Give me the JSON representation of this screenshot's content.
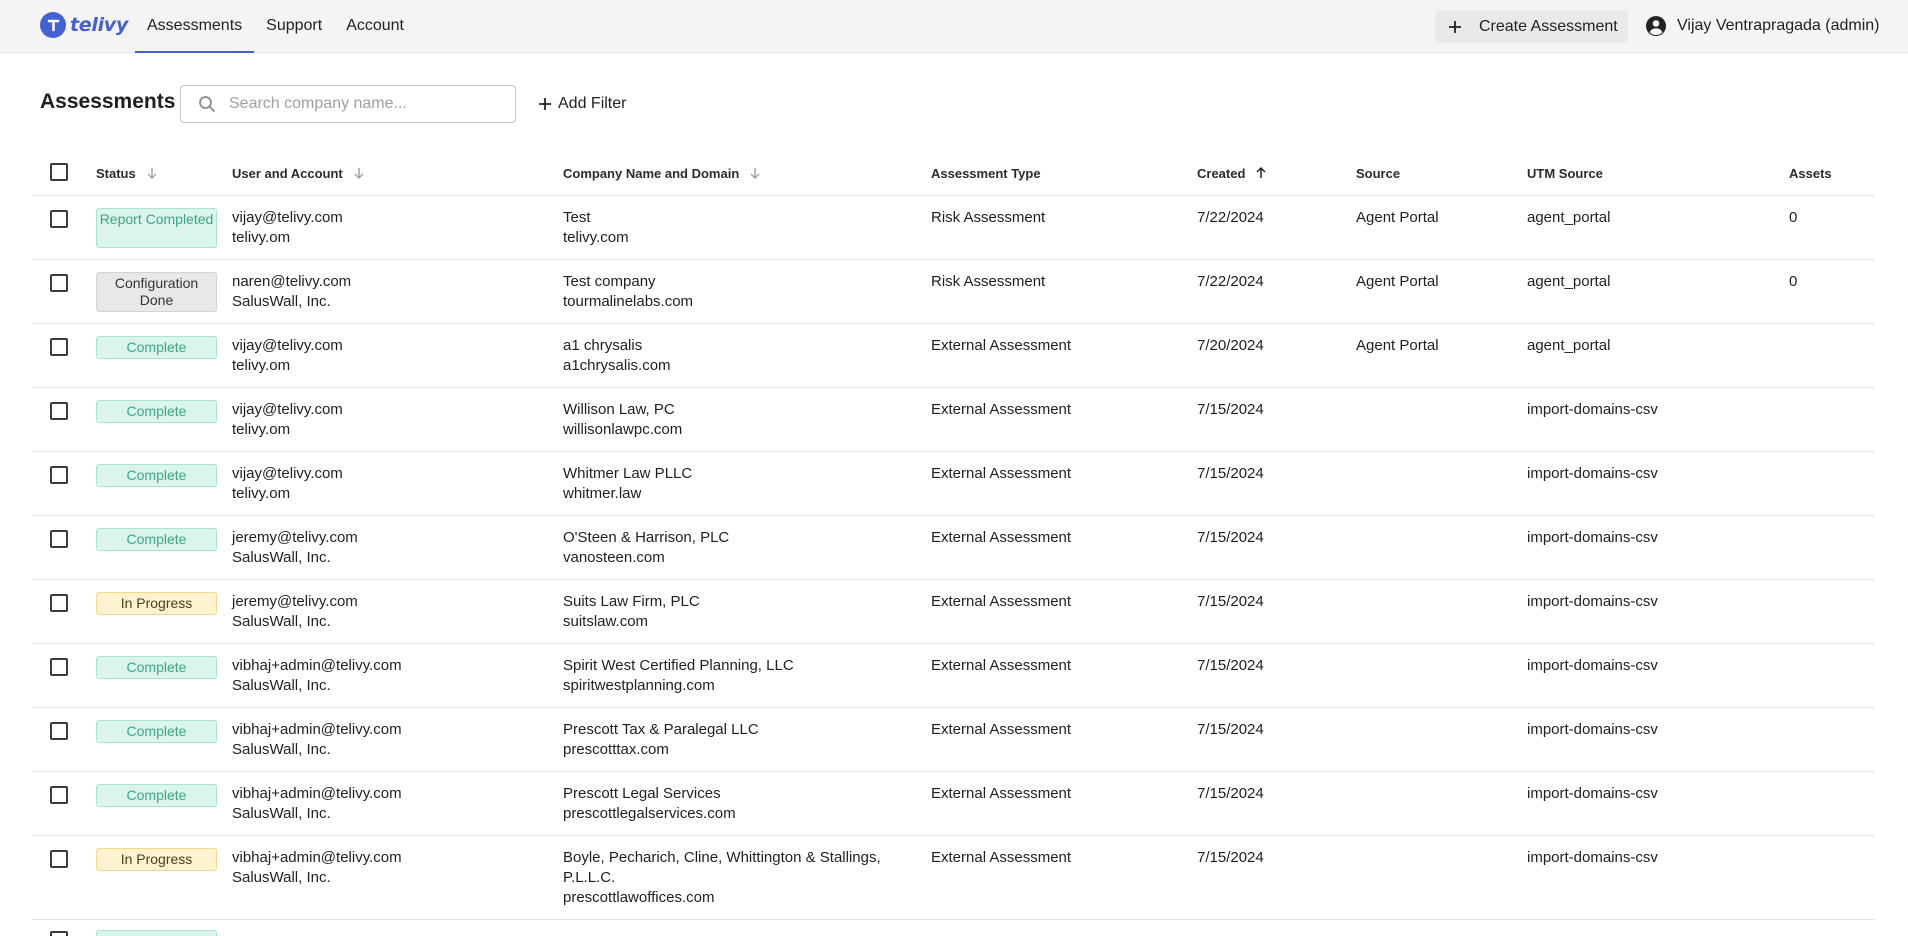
{
  "app": {
    "logo_text": "telivy"
  },
  "nav": {
    "items": [
      {
        "label": "Assessments",
        "active": true
      },
      {
        "label": "Support",
        "active": false
      },
      {
        "label": "Account",
        "active": false
      }
    ]
  },
  "header": {
    "create_label": "Create Assessment",
    "user_label": "Vijay Ventrapragada (admin)"
  },
  "page": {
    "title": "Assessments",
    "search_placeholder": "Search company name...",
    "search_value": "",
    "add_filter_label": "Add Filter"
  },
  "table": {
    "columns": {
      "status": "Status",
      "user": "User and Account",
      "company": "Company Name and Domain",
      "type": "Assessment Type",
      "created": "Created",
      "source": "Source",
      "utm": "UTM Source",
      "assets": "Assets"
    },
    "sort": {
      "column": "Created",
      "direction": "ascending"
    },
    "rows": [
      {
        "status": "Report Completed",
        "status_color": "green",
        "user": "vijay@telivy.com",
        "account": "telivy.om",
        "company": "Test",
        "domain": "telivy.com",
        "type": "Risk Assessment",
        "created": "7/22/2024",
        "source": "Agent Portal",
        "utm": "agent_portal",
        "assets": "0"
      },
      {
        "status": "Configuration Done",
        "status_color": "gray",
        "user": "naren@telivy.com",
        "account": "SalusWall, Inc.",
        "company": "Test company",
        "domain": "tourmalinelabs.com",
        "type": "Risk Assessment",
        "created": "7/22/2024",
        "source": "Agent Portal",
        "utm": "agent_portal",
        "assets": "0"
      },
      {
        "status": "Complete",
        "status_color": "green",
        "user": "vijay@telivy.com",
        "account": "telivy.om",
        "company": "a1 chrysalis",
        "domain": "a1chrysalis.com",
        "type": "External Assessment",
        "created": "7/20/2024",
        "source": "Agent Portal",
        "utm": "agent_portal",
        "assets": ""
      },
      {
        "status": "Complete",
        "status_color": "green",
        "user": "vijay@telivy.com",
        "account": "telivy.om",
        "company": "Willison Law, PC",
        "domain": "willisonlawpc.com",
        "type": "External Assessment",
        "created": "7/15/2024",
        "source": "",
        "utm": "import-domains-csv",
        "assets": ""
      },
      {
        "status": "Complete",
        "status_color": "green",
        "user": "vijay@telivy.com",
        "account": "telivy.om",
        "company": "Whitmer Law PLLC",
        "domain": "whitmer.law",
        "type": "External Assessment",
        "created": "7/15/2024",
        "source": "",
        "utm": "import-domains-csv",
        "assets": ""
      },
      {
        "status": "Complete",
        "status_color": "green",
        "user": "jeremy@telivy.com",
        "account": "SalusWall, Inc.",
        "company": "O'Steen & Harrison, PLC",
        "domain": "vanosteen.com",
        "type": "External Assessment",
        "created": "7/15/2024",
        "source": "",
        "utm": "import-domains-csv",
        "assets": ""
      },
      {
        "status": "In Progress",
        "status_color": "yellow",
        "user": "jeremy@telivy.com",
        "account": "SalusWall, Inc.",
        "company": "Suits Law Firm, PLC",
        "domain": "suitslaw.com",
        "type": "External Assessment",
        "created": "7/15/2024",
        "source": "",
        "utm": "import-domains-csv",
        "assets": ""
      },
      {
        "status": "Complete",
        "status_color": "green",
        "user": "vibhaj+admin@telivy.com",
        "account": "SalusWall, Inc.",
        "company": "Spirit West Certified Planning, LLC",
        "domain": "spiritwestplanning.com",
        "type": "External Assessment",
        "created": "7/15/2024",
        "source": "",
        "utm": "import-domains-csv",
        "assets": ""
      },
      {
        "status": "Complete",
        "status_color": "green",
        "user": "vibhaj+admin@telivy.com",
        "account": "SalusWall, Inc.",
        "company": "Prescott Tax & Paralegal LLC",
        "domain": "prescotttax.com",
        "type": "External Assessment",
        "created": "7/15/2024",
        "source": "",
        "utm": "import-domains-csv",
        "assets": ""
      },
      {
        "status": "Complete",
        "status_color": "green",
        "user": "vibhaj+admin@telivy.com",
        "account": "SalusWall, Inc.",
        "company": "Prescott Legal Services",
        "domain": "prescottlegalservices.com",
        "type": "External Assessment",
        "created": "7/15/2024",
        "source": "",
        "utm": "import-domains-csv",
        "assets": ""
      },
      {
        "status": "In Progress",
        "status_color": "yellow",
        "user": "vibhaj+admin@telivy.com",
        "account": "SalusWall, Inc.",
        "company": "Boyle, Pecharich, Cline, Whittington & Stallings, P.L.L.C.",
        "domain": "prescottlawoffices.com",
        "type": "External Assessment",
        "created": "7/15/2024",
        "source": "",
        "utm": "import-domains-csv",
        "assets": ""
      }
    ]
  },
  "colors": {
    "brand": "#4460d6",
    "complete_text": "#3aa77c",
    "complete_bg": "#dcf5ec",
    "in_progress_bg": "#fdf3d0",
    "config_bg": "#e8e8ea"
  }
}
